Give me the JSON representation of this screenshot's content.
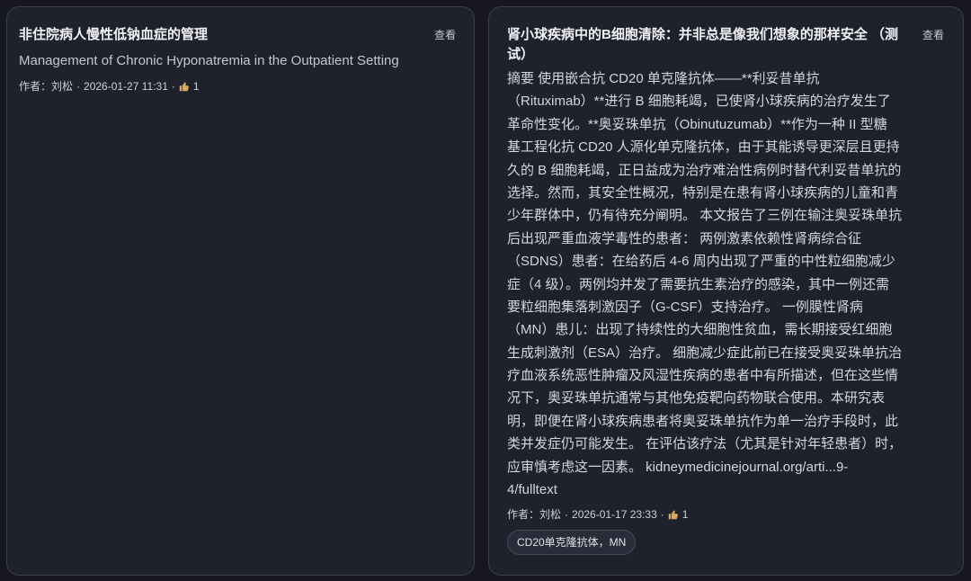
{
  "colors": {
    "page_bg": "#17181f",
    "card_bg": "#1f212c",
    "card_border": "#3a3d4b",
    "title_text": "#f2f3f6",
    "body_text": "#d5d7de",
    "secondary_text": "#c4c7d0",
    "meta_text": "#cfd1d9",
    "like_icon": "#dcaa5a",
    "tag_bg": "#2a2d39",
    "tag_border": "#464958",
    "tag_text": "#e1e2e7"
  },
  "cards": [
    {
      "title": "非住院病人慢性低钠血症的管理",
      "view_label": "查看",
      "subtitle": "Management of Chronic Hyponatremia in the Outpatient Setting",
      "meta": {
        "author": "作者：刘松",
        "separator": "·",
        "published": "2026-01-27 11:31",
        "like_icon": "thumbs-up-icon",
        "likes": 1
      }
    },
    {
      "title": "肾小球疾病中的B细胞清除：并非总是像我们想象的那样安全 （测试）",
      "view_label": "查看",
      "abstract_lines": [
        "摘要 使用嵌合抗 CD20 单克隆抗体——**利妥昔单抗",
        "（Rituximab）**进行 B 细胞耗竭，已使肾小球疾病的治疗发生了",
        "革命性变化。**奥妥珠单抗（Obinutuzumab）**作为一种 II 型糖",
        "基工程化抗 CD20 人源化单克隆抗体，由于其能诱导更深层且更持",
        "久的 B 细胞耗竭，正日益成为治疗难治性病例时替代利妥昔单抗的",
        "选择。然而，其安全性概况，特别是在患有肾小球疾病的儿童和青",
        "少年群体中，仍有待充分阐明。 本文报告了三例在输注奥妥珠单抗",
        "后出现严重血液学毒性的患者： 两例激素依赖性肾病综合征",
        "（SDNS）患者：在给药后 4-6 周内出现了严重的中性粒细胞减少",
        "症（4 级）。两例均并发了需要抗生素治疗的感染，其中一例还需",
        "要粒细胞集落刺激因子（G-CSF）支持治疗。 一例膜性肾病",
        "（MN）患儿：出现了持续性的大细胞性贫血，需长期接受红细胞",
        "生成刺激剂（ESA）治疗。 细胞减少症此前已在接受奥妥珠单抗治",
        "疗血液系统恶性肿瘤及风湿性疾病的患者中有所描述，但在这些情",
        "况下，奥妥珠单抗通常与其他免疫靶向药物联合使用。本研究表",
        "明，即便在肾小球疾病患者将奥妥珠单抗作为单一治疗手段时，此",
        "类并发症仍可能发生。 在评估该疗法（尤其是针对年轻患者）时，",
        "应审慎考虑这一因素。 kidneymedicinejournal.org/arti...9-",
        "4/fulltext"
      ],
      "meta": {
        "author": "作者：刘松",
        "separator": "·",
        "published": "2026-01-17 23:33",
        "like_icon": "thumbs-up-icon",
        "likes": 1
      },
      "tags": [
        "CD20单克隆抗体，MN"
      ]
    }
  ]
}
